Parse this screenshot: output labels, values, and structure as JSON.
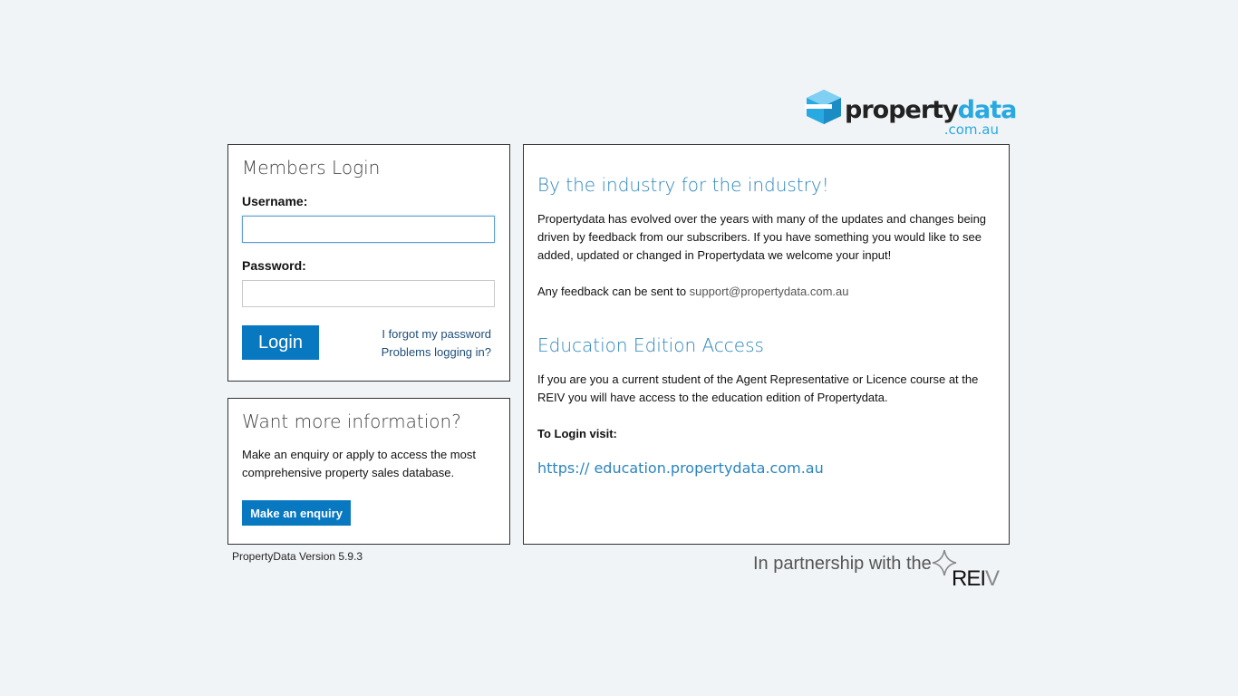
{
  "brand": {
    "logo_word_main": "property",
    "logo_word_accent": "data",
    "logo_domain": ".com.au",
    "accent_color": "#29a9e1",
    "button_color": "#0878c1"
  },
  "login": {
    "title": "Members Login",
    "username_label": "Username:",
    "username_value": "",
    "password_label": "Password:",
    "password_value": "",
    "login_button": "Login",
    "forgot_password": "I forgot my password",
    "problems_logging": "Problems logging in?"
  },
  "info": {
    "title": "Want more information?",
    "text": "Make an enquiry or apply to access the most comprehensive property sales database.",
    "enquiry_button": "Make an enquiry"
  },
  "right": {
    "heading1": "By the industry for the industry!",
    "para1": "Propertydata has evolved over the years with many of the updates and changes being driven by feedback from our subscribers. If you have something you would like to see added, updated or changed in Propertydata we welcome your input!",
    "feedback_prefix": "Any feedback can be sent to ",
    "feedback_email": "support@propertydata.com.au",
    "heading2": "Education Edition Access",
    "para2": "If you are you a current student of the Agent Representative or Licence course at the REIV you will have access to the education edition of Propertydata.",
    "login_visit_label": "To Login visit:",
    "edu_link": "https:// education.propertydata.com.au"
  },
  "footer": {
    "version": "PropertyData Version 5.9.3",
    "partnership": "In partnership with the",
    "reiv_main": "REI",
    "reiv_end": "V"
  }
}
